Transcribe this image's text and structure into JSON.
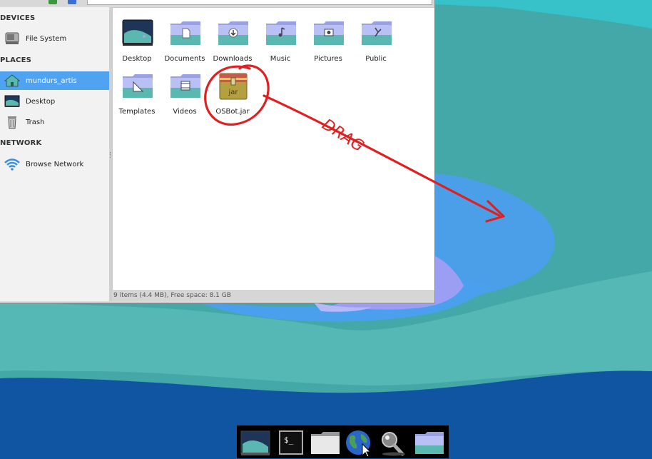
{
  "window": {
    "sidebar": {
      "sections": [
        {
          "heading": "DEVICES",
          "items": [
            {
              "label": "File System",
              "icon": "harddrive-icon"
            }
          ]
        },
        {
          "heading": "PLACES",
          "items": [
            {
              "label": "mundurs_artis",
              "icon": "home-folder-icon",
              "selected": true
            },
            {
              "label": "Desktop",
              "icon": "desktop-icon"
            },
            {
              "label": "Trash",
              "icon": "trash-icon"
            }
          ]
        },
        {
          "heading": "NETWORK",
          "items": [
            {
              "label": "Browse Network",
              "icon": "wifi-icon"
            }
          ]
        }
      ]
    },
    "files": [
      {
        "label": "Desktop",
        "icon": "desktop-folder-icon"
      },
      {
        "label": "Documents",
        "icon": "documents-folder-icon"
      },
      {
        "label": "Downloads",
        "icon": "downloads-folder-icon"
      },
      {
        "label": "Music",
        "icon": "music-folder-icon"
      },
      {
        "label": "Pictures",
        "icon": "pictures-folder-icon"
      },
      {
        "label": "Public",
        "icon": "public-folder-icon"
      },
      {
        "label": "Templates",
        "icon": "templates-folder-icon"
      },
      {
        "label": "Videos",
        "icon": "videos-folder-icon"
      },
      {
        "label": "OSBot.jar",
        "icon": "jar-file-icon",
        "icon_text": "jar"
      }
    ],
    "status": "9 items (4.4 MB), Free space: 8.1 GB"
  },
  "annotation": {
    "text": "DRAG",
    "color": "#e02020"
  },
  "dock": [
    {
      "name": "show-desktop-icon"
    },
    {
      "name": "terminal-icon",
      "glyph": "$_"
    },
    {
      "name": "file-manager-icon"
    },
    {
      "name": "web-browser-icon"
    },
    {
      "name": "app-finder-icon"
    },
    {
      "name": "home-folder-icon"
    }
  ],
  "colors": {
    "selection": "#4fa3f0",
    "folder_teal": "#5bb8b0",
    "folder_lavender": "#b8b8f0",
    "desktop_dark": "#0e56a4",
    "annotation_red": "#e02020"
  }
}
